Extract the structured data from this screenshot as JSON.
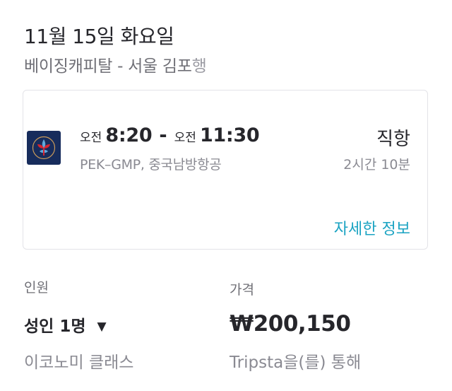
{
  "header": {
    "date": "11월 15일 화요일",
    "route": "베이징캐피탈 - 서울 김포",
    "route_suffix": "행"
  },
  "flight": {
    "airline_logo": "china-southern-airlines-logo",
    "depart_ampm": "오전",
    "depart_time": "8:20",
    "separator": "-",
    "arrive_ampm": "오전",
    "arrive_time": "11:30",
    "segment": "PEK–GMP, 중국남방항공",
    "stops": "직항",
    "duration": "2시간 10분",
    "details_link": "자세한 정보"
  },
  "booking": {
    "passengers_label": "인원",
    "passengers_value": "성인 1명",
    "cabin": "이코노미 클래스",
    "price_label": "가격",
    "price": "₩200,150",
    "via": "Tripsta을(를) 통해"
  },
  "colors": {
    "accent": "#1aa3c2",
    "logo_bg": "#172c5c",
    "logo_red": "#d6242f",
    "logo_blue": "#5fa8db"
  }
}
